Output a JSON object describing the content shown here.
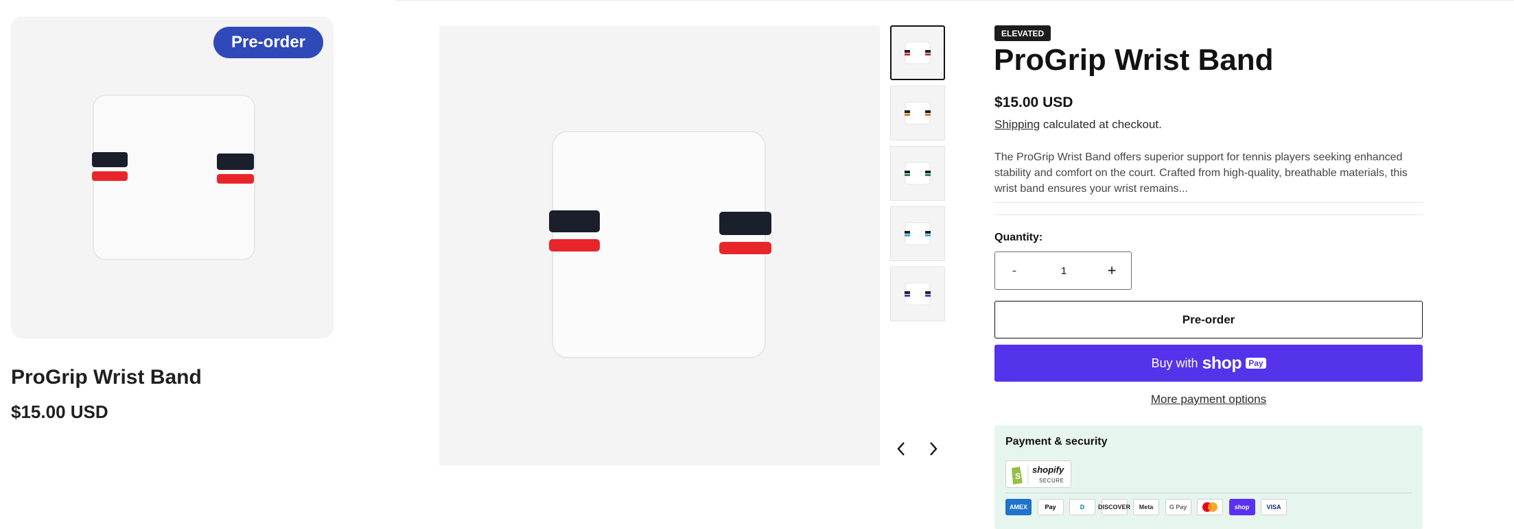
{
  "card": {
    "badge": "Pre-order",
    "title": "ProGrip Wrist Band",
    "price": "$15.00 USD"
  },
  "product": {
    "badge": "ELEVATED",
    "title": "ProGrip Wrist Band",
    "price": "$15.00 USD",
    "shipping_link": "Shipping",
    "shipping_rest": " calculated at checkout.",
    "description": "The ProGrip Wrist Band offers superior support for tennis players seeking enhanced stability and comfort on the court. Crafted from high-quality, breathable materials, this wrist band ensures your wrist remains..."
  },
  "quantity": {
    "label": "Quantity:",
    "minus": "-",
    "value": "1",
    "plus": "+"
  },
  "buttons": {
    "preorder": "Pre-order",
    "buy_with": "Buy with",
    "shop_word": "shop",
    "pay_chip": "Pay",
    "more_payment": "More payment options"
  },
  "security": {
    "title": "Payment & security",
    "shopify_word": "shopify",
    "secure_word": "SECURE",
    "payment_methods": [
      {
        "label": "AMEX",
        "icon": "amex-icon",
        "bg": "#1f72cd",
        "fg": "#ffffff"
      },
      {
        "label": "Pay",
        "icon": "apple-pay-icon",
        "bg": "#ffffff",
        "fg": "#000000"
      },
      {
        "label": "D",
        "icon": "diners-club-icon",
        "bg": "#ffffff",
        "fg": "#0079be"
      },
      {
        "label": "DISCOVER",
        "icon": "discover-icon",
        "bg": "#ffffff",
        "fg": "#231f20"
      },
      {
        "label": "Meta",
        "icon": "meta-pay-icon",
        "bg": "#ffffff",
        "fg": "#1c2b33"
      },
      {
        "label": "G Pay",
        "icon": "google-pay-icon",
        "bg": "#ffffff",
        "fg": "#5f6368"
      },
      {
        "label": "",
        "icon": "mastercard-icon",
        "bg": "#ffffff",
        "fg": "#eb001b"
      },
      {
        "label": "shop",
        "icon": "shop-pay-icon",
        "bg": "#5a31f4",
        "fg": "#ffffff"
      },
      {
        "label": "VISA",
        "icon": "visa-icon",
        "bg": "#ffffff",
        "fg": "#142688"
      }
    ]
  },
  "gallery": {
    "thumb_stripe_colors": [
      "#d62a2a",
      "#e07a1a",
      "#2a8a3a",
      "#2ab0d8",
      "#4a3adb"
    ],
    "prev_icon": "chevron-left-icon",
    "next_icon": "chevron-right-icon"
  },
  "colors": {
    "accent_blue": "#2f4ab8",
    "shop_pay": "#5433eb",
    "security_bg": "#e7f5ef"
  }
}
